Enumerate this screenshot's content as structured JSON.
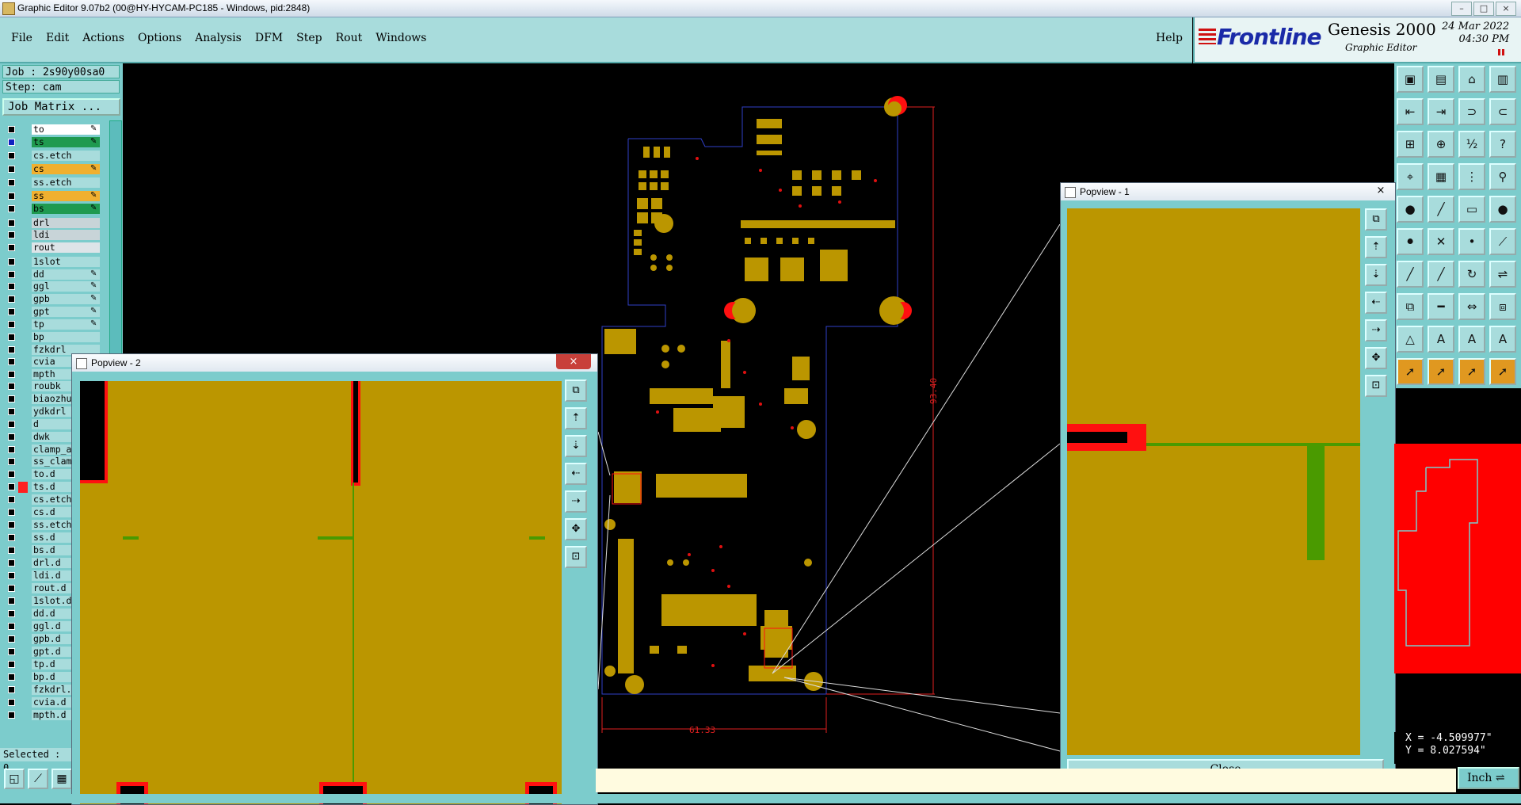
{
  "window": {
    "title": "Graphic Editor 9.07b2 (00@HY-HYCAM-PC185 - Windows, pid:2848)"
  },
  "menu": {
    "items": [
      "File",
      "Edit",
      "Actions",
      "Options",
      "Analysis",
      "DFM",
      "Step",
      "Rout",
      "Windows"
    ],
    "help": "Help"
  },
  "brand": {
    "logo": "Frontline",
    "product": "Genesis 2000",
    "subtitle": "Graphic Editor",
    "date": "24 Mar 2022",
    "time": "04:30 PM"
  },
  "job": {
    "job_label": "Job : 2s90y00sa0",
    "step_label": "Step: cam",
    "matrix_button": "Job Matrix ..."
  },
  "layers": [
    {
      "name": "to",
      "color": "#ffffff",
      "selected": false,
      "editable": true
    },
    {
      "name": "ts",
      "color": "#1f9a50",
      "selected": true,
      "editable": true
    },
    {
      "name": "cs.etch",
      "color": "#a8dcdc",
      "selected": false,
      "editable": false
    },
    {
      "name": "cs",
      "color": "#f0b030",
      "selected": false,
      "editable": true
    },
    {
      "name": "ss.etch",
      "color": "#a8dcdc",
      "selected": false,
      "editable": false
    },
    {
      "name": "ss",
      "color": "#f0b030",
      "selected": false,
      "editable": true
    },
    {
      "name": "bs",
      "color": "#1f9a50",
      "selected": false,
      "editable": true
    },
    {
      "name": "drl",
      "color": "#c8d4d8",
      "selected": false,
      "editable": false
    },
    {
      "name": "ldi",
      "color": "#c8d4d8",
      "selected": false,
      "editable": false
    },
    {
      "name": "rout",
      "color": "#dde4e8",
      "selected": false,
      "editable": false
    },
    {
      "name": "1slot",
      "color": "#a8dcdc",
      "selected": false,
      "editable": false
    },
    {
      "name": "dd",
      "color": "#a8dcdc",
      "selected": false,
      "editable": true
    },
    {
      "name": "ggl",
      "color": "#a8dcdc",
      "selected": false,
      "editable": true
    },
    {
      "name": "gpb",
      "color": "#a8dcdc",
      "selected": false,
      "editable": true
    },
    {
      "name": "gpt",
      "color": "#a8dcdc",
      "selected": false,
      "editable": true
    },
    {
      "name": "tp",
      "color": "#a8dcdc",
      "selected": false,
      "editable": true
    },
    {
      "name": "bp",
      "color": "#a8dcdc",
      "selected": false,
      "editable": false
    },
    {
      "name": "fzkdrl",
      "color": "#a8dcdc",
      "selected": false,
      "editable": false
    },
    {
      "name": "cvia",
      "color": "#a8dcdc",
      "selected": false,
      "editable": false
    },
    {
      "name": "mpth",
      "color": "#a8dcdc",
      "selected": false,
      "editable": false
    },
    {
      "name": "roubk",
      "color": "#a8dcdc",
      "selected": false,
      "editable": false
    },
    {
      "name": "biaozhu",
      "color": "#a8dcdc",
      "selected": false,
      "editable": false
    },
    {
      "name": "ydkdrl",
      "color": "#a8dcdc",
      "selected": false,
      "editable": false
    },
    {
      "name": "d",
      "color": "#a8dcdc",
      "selected": false,
      "editable": false
    },
    {
      "name": "dwk",
      "color": "#a8dcdc",
      "selected": false,
      "editable": false
    },
    {
      "name": "clamp_a",
      "color": "#a8dcdc",
      "selected": false,
      "editable": false
    },
    {
      "name": "ss_clam",
      "color": "#a8dcdc",
      "selected": false,
      "editable": false
    },
    {
      "name": "to.d",
      "color": "#a8dcdc",
      "selected": false,
      "editable": false
    },
    {
      "name": "ts.d",
      "color": "#a8dcdc",
      "selected": false,
      "editable": false,
      "marker": "#ff2020"
    },
    {
      "name": "cs.etch",
      "color": "#a8dcdc",
      "selected": false,
      "editable": false
    },
    {
      "name": "cs.d",
      "color": "#a8dcdc",
      "selected": false,
      "editable": false
    },
    {
      "name": "ss.etch",
      "color": "#a8dcdc",
      "selected": false,
      "editable": false
    },
    {
      "name": "ss.d",
      "color": "#a8dcdc",
      "selected": false,
      "editable": false
    },
    {
      "name": "bs.d",
      "color": "#a8dcdc",
      "selected": false,
      "editable": false
    },
    {
      "name": "drl.d",
      "color": "#a8dcdc",
      "selected": false,
      "editable": false
    },
    {
      "name": "ldi.d",
      "color": "#a8dcdc",
      "selected": false,
      "editable": false
    },
    {
      "name": "rout.d",
      "color": "#a8dcdc",
      "selected": false,
      "editable": false
    },
    {
      "name": "1slot.d",
      "color": "#a8dcdc",
      "selected": false,
      "editable": false
    },
    {
      "name": "dd.d",
      "color": "#a8dcdc",
      "selected": false,
      "editable": false
    },
    {
      "name": "ggl.d",
      "color": "#a8dcdc",
      "selected": false,
      "editable": false
    },
    {
      "name": "gpb.d",
      "color": "#a8dcdc",
      "selected": false,
      "editable": false
    },
    {
      "name": "gpt.d",
      "color": "#a8dcdc",
      "selected": false,
      "editable": false
    },
    {
      "name": "tp.d",
      "color": "#a8dcdc",
      "selected": false,
      "editable": false
    },
    {
      "name": "bp.d",
      "color": "#a8dcdc",
      "selected": false,
      "editable": false
    },
    {
      "name": "fzkdrl.",
      "color": "#a8dcdc",
      "selected": false,
      "editable": false
    },
    {
      "name": "cvia.d",
      "color": "#a8dcdc",
      "selected": false,
      "editable": false
    },
    {
      "name": "mpth.d",
      "color": "#a8dcdc",
      "selected": false,
      "editable": false
    }
  ],
  "selected_label": "Selected : 0",
  "popview2": {
    "title": "Popview - 2",
    "close": "×"
  },
  "popview1": {
    "title": "Popview - 1",
    "close": "×",
    "close_button": "Close"
  },
  "dimensions": {
    "height": "93.40",
    "width": "61.33"
  },
  "coords": {
    "x": "X = -4.509977\"",
    "y": "Y = 8.027594\""
  },
  "unit": "Inch",
  "colors": {
    "board_fill": "#bb9600",
    "board_outline": "#3040c8",
    "highlight": "#ff0000",
    "ui_teal": "#7ccccc"
  }
}
